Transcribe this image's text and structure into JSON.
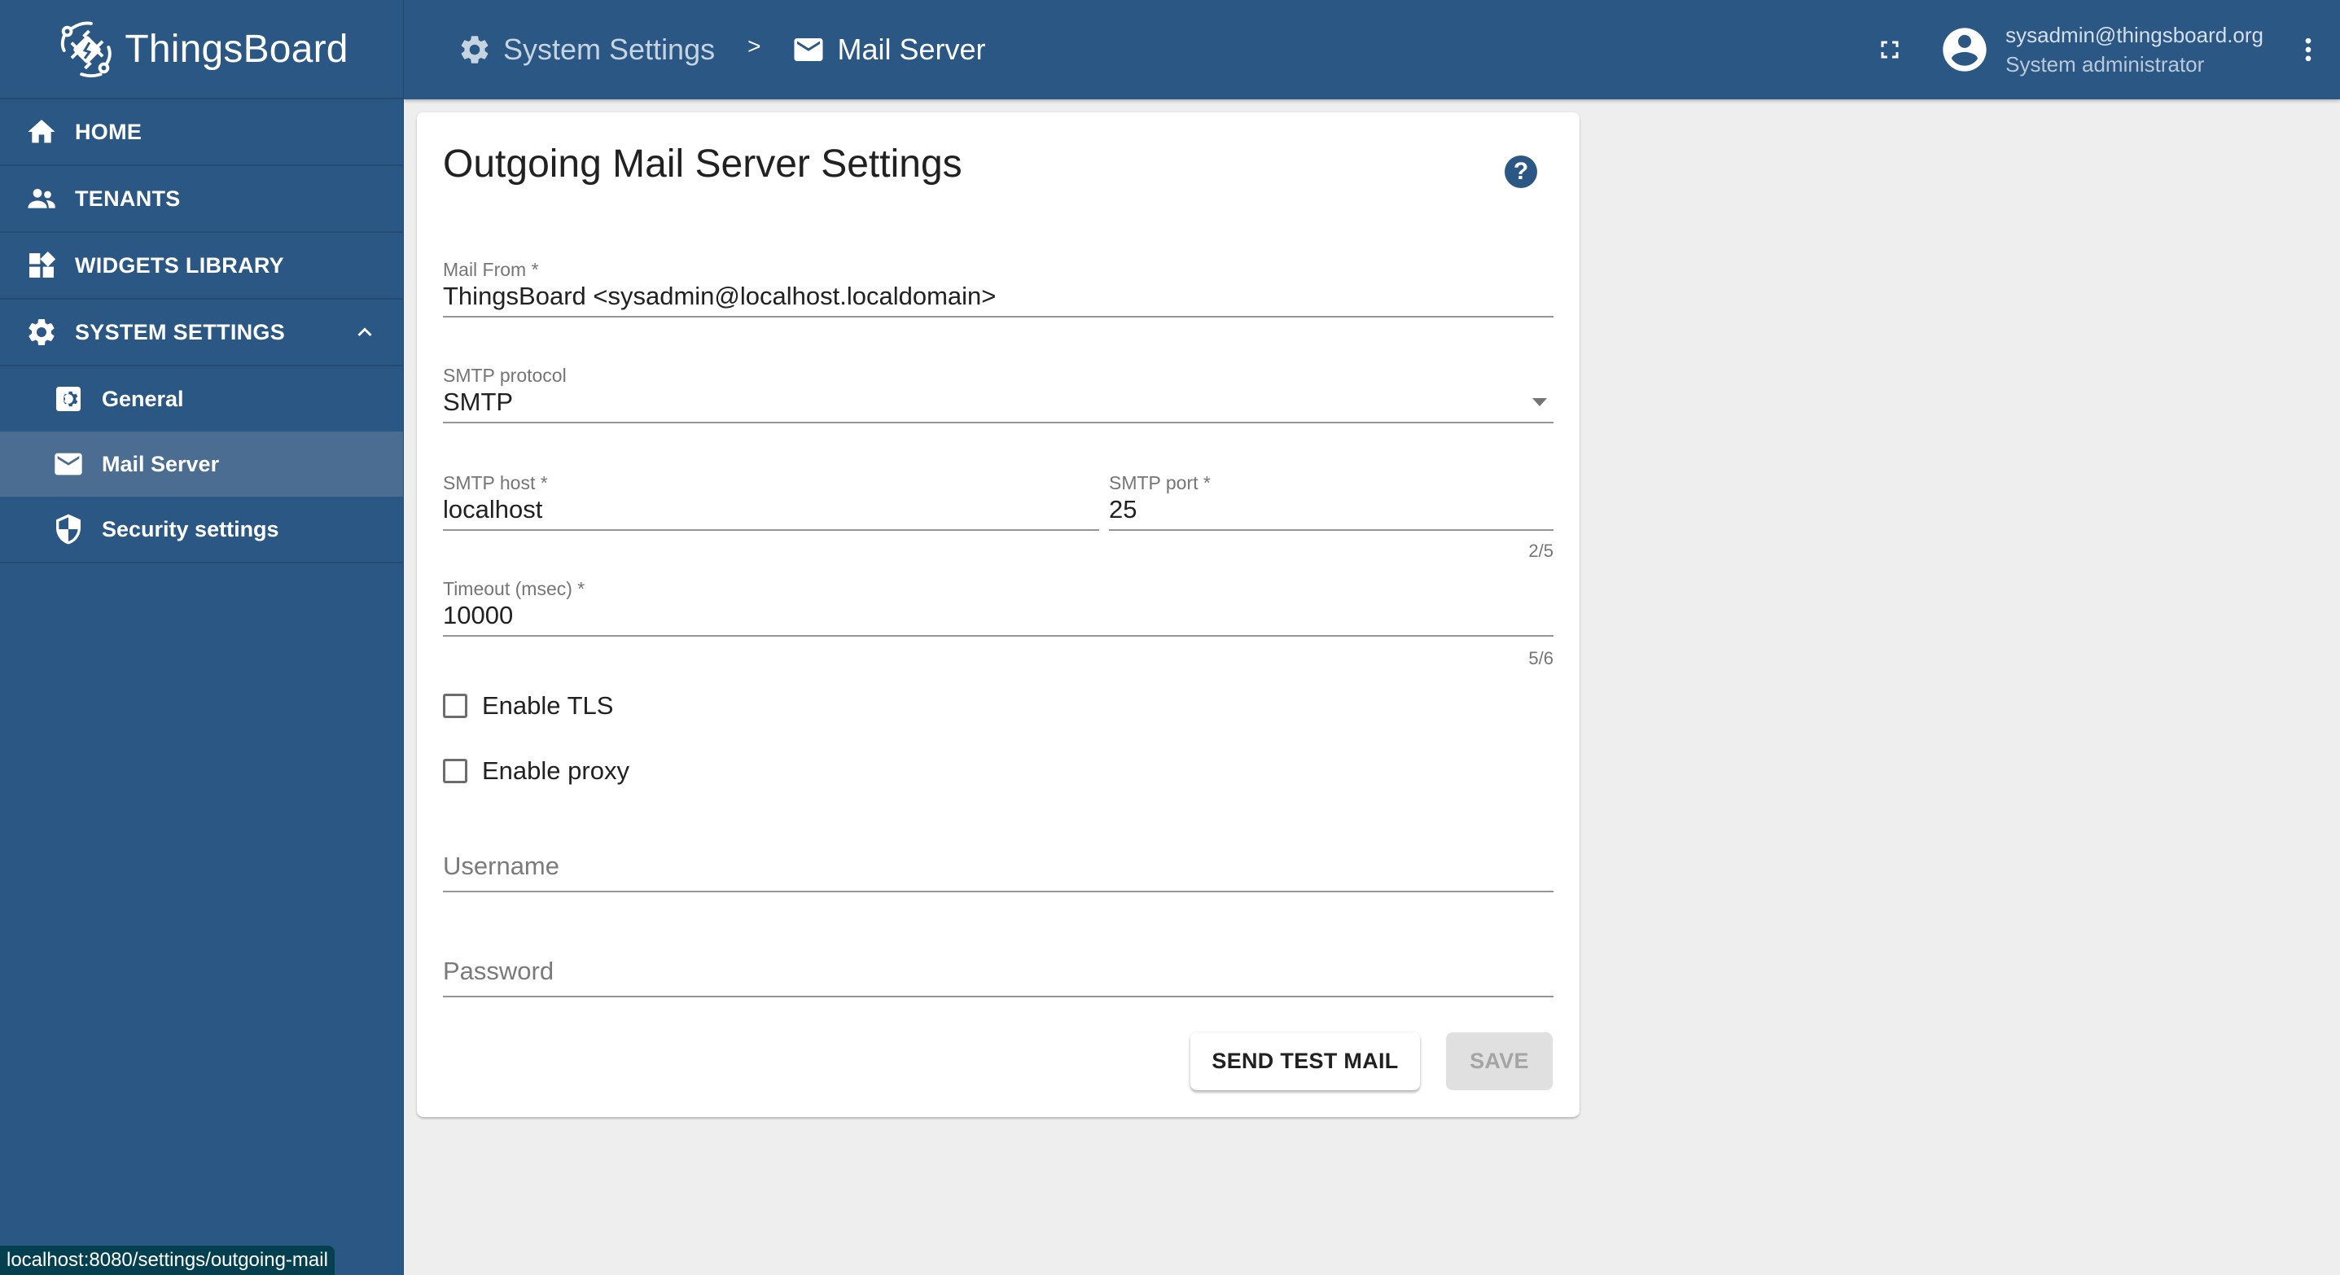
{
  "app": {
    "name": "ThingsBoard"
  },
  "header": {
    "breadcrumbs": [
      {
        "label": "System Settings",
        "icon": "gear-icon"
      },
      {
        "label": "Mail Server",
        "icon": "mail-icon"
      }
    ],
    "separator": ">",
    "user": {
      "email": "sysadmin@thingsboard.org",
      "role": "System administrator"
    }
  },
  "sidebar": {
    "items": [
      {
        "label": "HOME",
        "icon": "home-icon"
      },
      {
        "label": "TENANTS",
        "icon": "tenants-icon"
      },
      {
        "label": "WIDGETS LIBRARY",
        "icon": "widgets-icon"
      },
      {
        "label": "SYSTEM SETTINGS",
        "icon": "gear-icon",
        "expanded": true
      }
    ],
    "subitems": [
      {
        "label": "General",
        "icon": "settings-box-icon"
      },
      {
        "label": "Mail Server",
        "icon": "mail-icon",
        "active": true
      },
      {
        "label": "Security settings",
        "icon": "shield-icon"
      }
    ]
  },
  "form": {
    "title": "Outgoing Mail Server Settings",
    "help_symbol": "?",
    "mail_from": {
      "label": "Mail From *",
      "value": "ThingsBoard <sysadmin@localhost.localdomain>"
    },
    "smtp_protocol": {
      "label": "SMTP protocol",
      "value": "SMTP"
    },
    "smtp_host": {
      "label": "SMTP host *",
      "value": "localhost"
    },
    "smtp_port": {
      "label": "SMTP port *",
      "value": "25",
      "hint": "2/5"
    },
    "timeout": {
      "label": "Timeout (msec) *",
      "value": "10000",
      "hint": "5/6"
    },
    "enable_tls": {
      "label": "Enable TLS",
      "checked": false
    },
    "enable_proxy": {
      "label": "Enable proxy",
      "checked": false
    },
    "username": {
      "placeholder": "Username",
      "value": ""
    },
    "password": {
      "placeholder": "Password",
      "value": ""
    },
    "send_test_mail_label": "SEND TEST MAIL",
    "save_label": "SAVE"
  },
  "status_bar": {
    "url": "localhost:8080/settings/outgoing-mail"
  },
  "colors": {
    "primary": "#2a5783",
    "sidebar_active": "#4a6d91",
    "background": "#eeeeee"
  }
}
